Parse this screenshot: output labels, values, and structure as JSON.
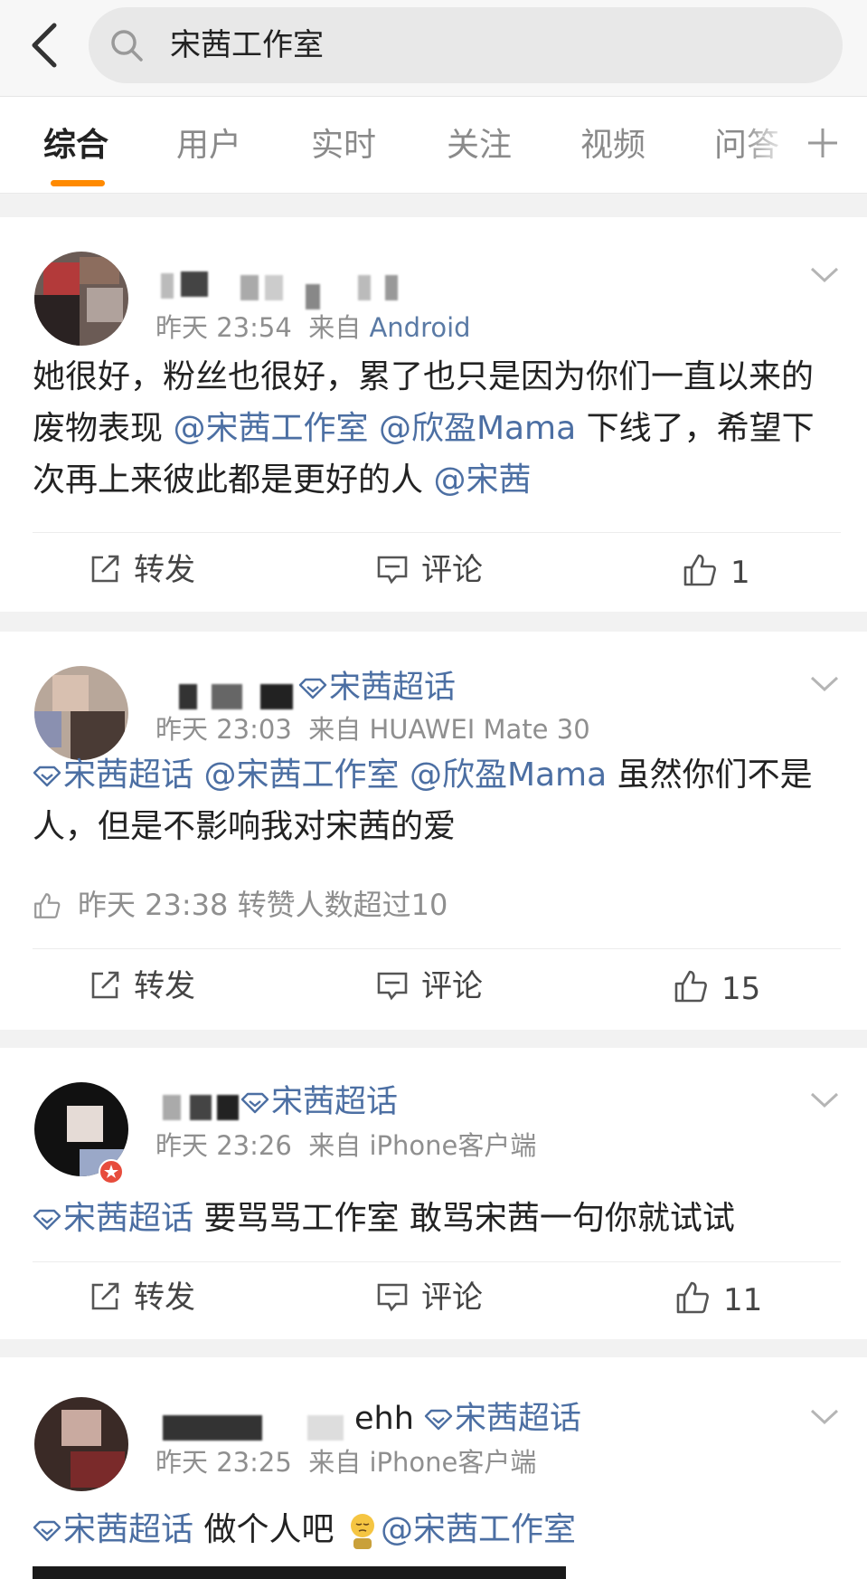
{
  "search": {
    "query": "宋茜工作室"
  },
  "tabs": [
    "综合",
    "用户",
    "实时",
    "关注",
    "视频",
    "问答"
  ],
  "colors": {
    "accent": "#ff8a00",
    "link": "#4c6fa3",
    "meta": "#8f8f8f"
  },
  "actions": {
    "repost": "转发",
    "comment": "评论"
  },
  "posts": [
    {
      "time": "昨天 23:54",
      "source_prefix": "来自",
      "source": "Android",
      "text_a": "她很好，粉丝也很好，累了也只是因为你们一直以来的废物表现",
      "mention_1": "@宋茜工作室",
      "mention_2": "@欣盈Mama",
      "text_b": "下线了，希望下次再上来彼此都是更好的人",
      "mention_3": "@宋茜",
      "likes": "1"
    },
    {
      "topic": "宋茜超话",
      "time": "昨天 23:03",
      "source_prefix": "来自",
      "source": "HUAWEI Mate 30",
      "topic_inline": "宋茜超话",
      "mention_1": "@宋茜工作室",
      "mention_2": "@欣盈Mama",
      "text_a": "虽然你们不是人，但是不影响我对宋茜的爱",
      "liked_time": "昨天 23:38",
      "liked_text": "转赞人数超过10",
      "likes": "15"
    },
    {
      "topic": "宋茜超话",
      "time": "昨天 23:26",
      "source_prefix": "来自",
      "source": "iPhone客户端",
      "topic_inline": "宋茜超话",
      "text_a": "要骂骂工作室 敢骂宋茜一句你就试试",
      "likes": "11"
    },
    {
      "name_suffix": "ehh",
      "topic": "宋茜超话",
      "time": "昨天 23:25",
      "source_prefix": "来自",
      "source": "iPhone客户端",
      "topic_inline": "宋茜超话",
      "text_a": "做个人吧",
      "mention_1": "@宋茜工作室"
    }
  ]
}
